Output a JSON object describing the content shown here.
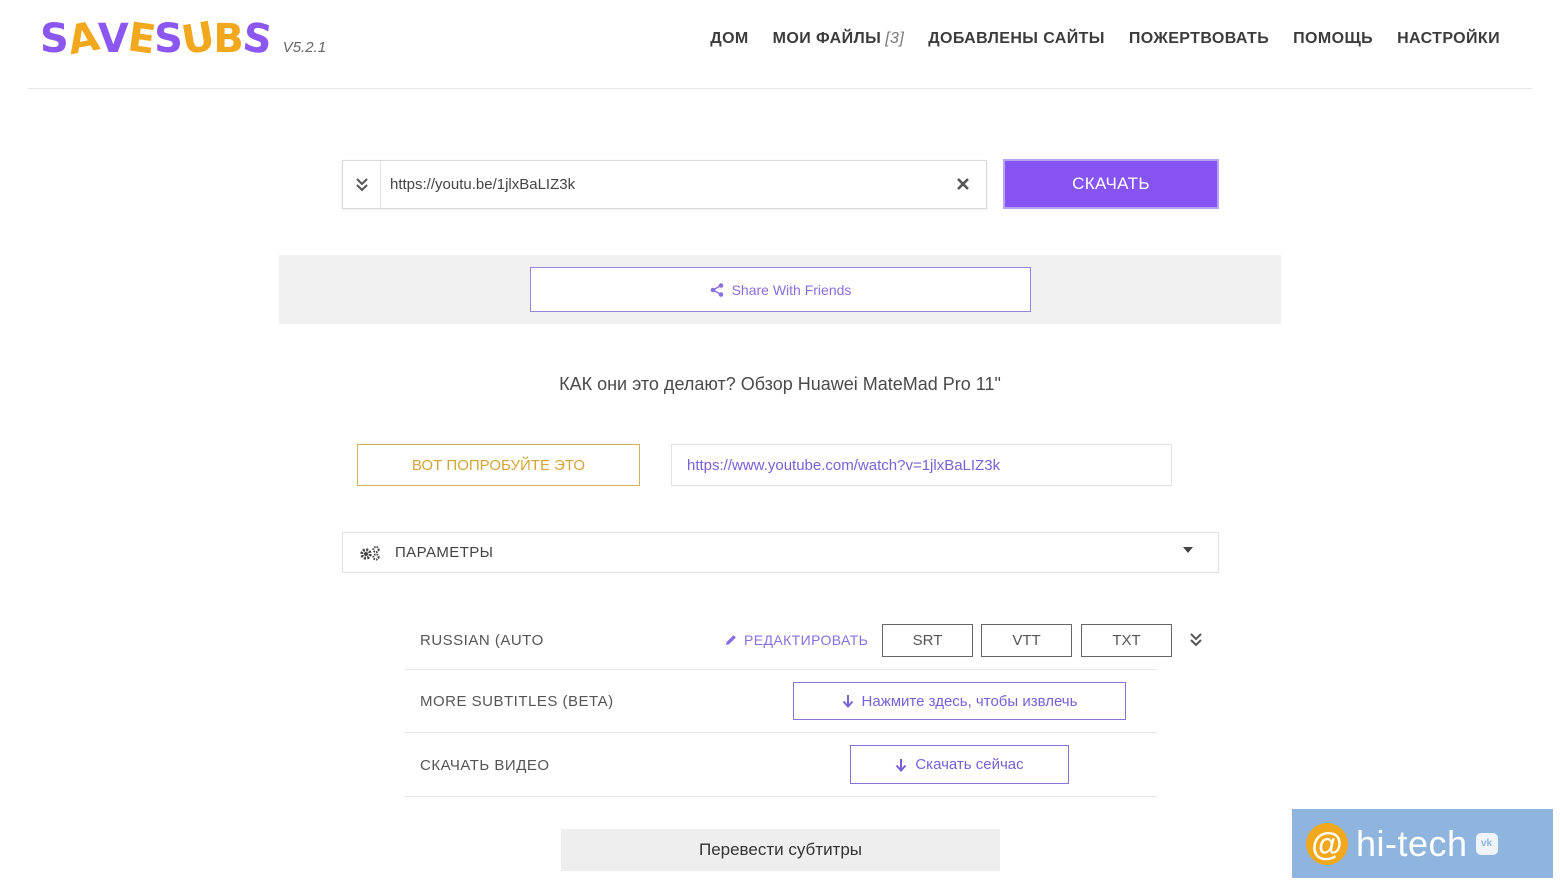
{
  "app": {
    "logo_text": "SaveSubs",
    "version": "V5.2.1"
  },
  "nav": {
    "home": "ДОМ",
    "my_files": "МОИ ФАЙЛЫ",
    "my_files_count": "[3]",
    "added_sites": "ДОБАВЛЕНЫ САЙТЫ",
    "donate": "ПОЖЕРТВОВАТЬ",
    "help": "ПОМОЩЬ",
    "settings": "НАСТРОЙКИ"
  },
  "url_form": {
    "value": "https://youtu.be/1jlxBaLIZ3k",
    "download_label": "СКАЧАТЬ"
  },
  "share": {
    "label": "Share With Friends"
  },
  "video": {
    "title": "КАК они это делают? Обзор Huawei MateMad Pro 11\"",
    "try_label": "ВОТ ПОПРОБУЙТЕ ЭТО",
    "full_url": "https://www.youtube.com/watch?v=1jlxBaLIZ3k"
  },
  "params": {
    "label": "ПАРАМЕТРЫ"
  },
  "subtitles": {
    "language": "RUSSIAN (AUTO",
    "edit_label": "РЕДАКТИРОВАТЬ",
    "formats": [
      "SRT",
      "VTT",
      "TXT"
    ],
    "more_label": "MORE SUBTITLES (BETA)",
    "extract_label": "Нажмите здесь, чтобы извлечь",
    "video_label": "СКАЧАТЬ ВИДЕО",
    "download_now_label": "Скачать сейчас"
  },
  "translate": {
    "label": "Перевести субтитры"
  },
  "watermark": {
    "text": "hi-tech"
  },
  "colors": {
    "accent": "#8654f2",
    "gold": "#d4a535",
    "watermark_bg": "#8fb5df"
  }
}
